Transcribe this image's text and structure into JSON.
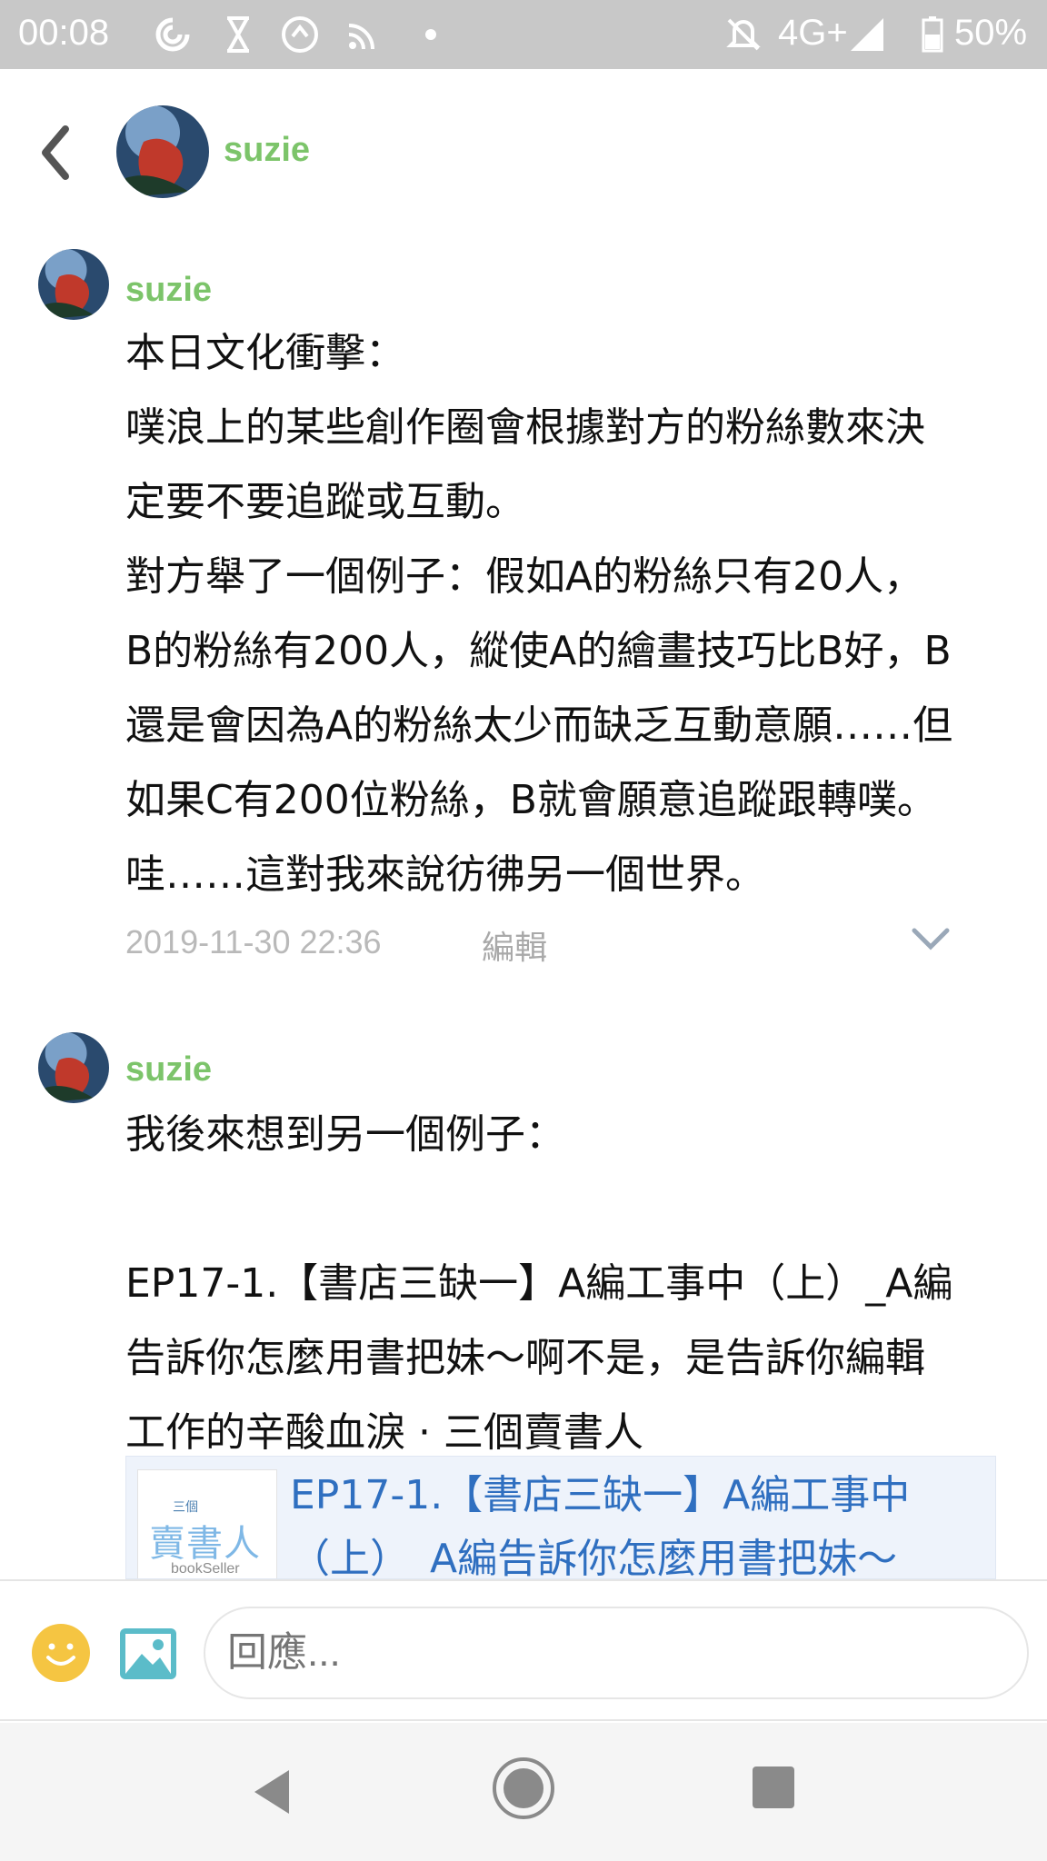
{
  "status_bar": {
    "time": "00:08",
    "network": "4G+",
    "battery": "50%",
    "icons": [
      "sync-icon",
      "hourglass-icon",
      "app-icon",
      "cast-icon",
      "dot-icon",
      "alarm-off-icon",
      "signal-icon",
      "battery-icon"
    ]
  },
  "header": {
    "username": "suzie"
  },
  "posts": [
    {
      "author": "suzie",
      "lines": [
        "本日文化衝擊：",
        "噗浪上的某些創作圈會根據對方的粉絲數來決",
        "定要不要追蹤或互動。",
        "對方舉了一個例子：假如A的粉絲只有20人，",
        "B的粉絲有200人，縱使A的繪畫技巧比B好，B",
        "還是會因為A的粉絲太少而缺乏互動意願……但",
        "如果C有200位粉絲，B就會願意追蹤跟轉噗。",
        "哇……這對我來說彷彿另一個世界。"
      ],
      "timestamp": "2019-11-30 22:36",
      "edit_label": "編輯"
    },
    {
      "author": "suzie",
      "lines": [
        "我後來想到另一個例子：",
        "",
        "EP17-1.【書店三缺一】A編工事中（上）_A編",
        "告訴你怎麼用書把妹～啊不是，是告訴你編輯",
        "工作的辛酸血淚 · 三個賣書人"
      ],
      "link_preview": {
        "thumb_small": "三個",
        "thumb_big": "賣書人",
        "thumb_sub": "bookSeller",
        "title_lines": [
          "EP17-1.【書店三缺一】A編工事中",
          "（上）_A編告訴你怎麼用書把妹～"
        ]
      }
    }
  ],
  "reply_bar": {
    "placeholder": "回應..."
  },
  "colors": {
    "accent_green": "#7cc46a",
    "link_blue": "#2f6fc0",
    "status_bar_bg": "#c8c8c8"
  }
}
